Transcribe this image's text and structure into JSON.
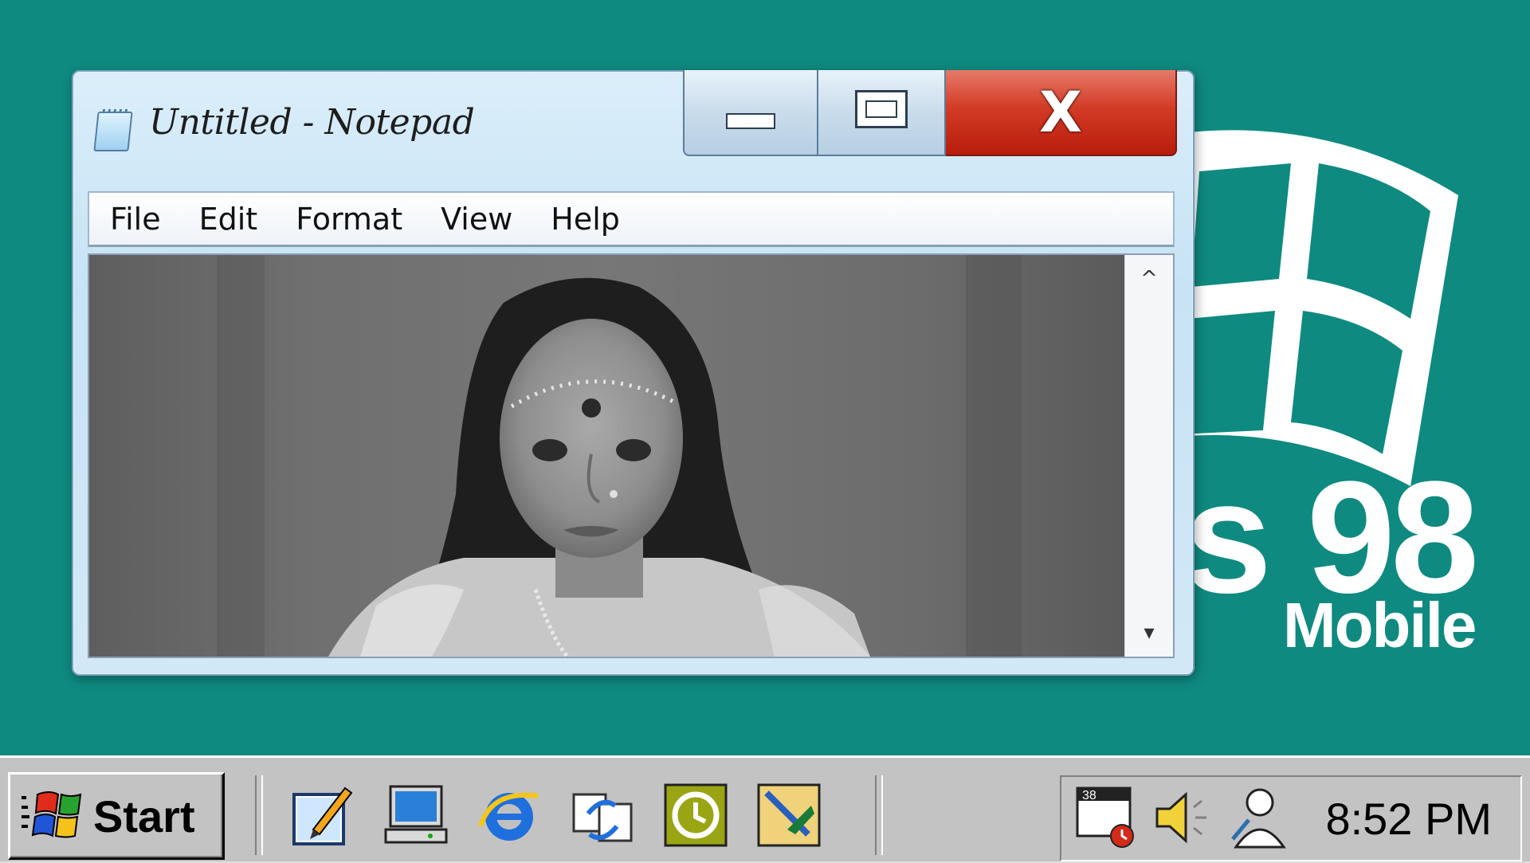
{
  "desktop": {
    "logo_os_text": "s 98",
    "logo_edition": "Mobile",
    "background_color": "#0f8a80"
  },
  "window": {
    "title": "Untitled - Notepad",
    "icon": "notepad-icon",
    "controls": {
      "minimize": "minimize-icon",
      "maximize": "maximize-icon",
      "close": "close-icon",
      "close_label": "X"
    },
    "menu": [
      "File",
      "Edit",
      "Format",
      "View",
      "Help"
    ],
    "content": {
      "type": "photo",
      "description_icon": "grayscale-portrait-image"
    },
    "scrollbar": {
      "up": "^",
      "down": "▾"
    }
  },
  "taskbar": {
    "start_label": "Start",
    "quick_launch": [
      "notepad-edit-icon",
      "my-computer-icon",
      "internet-explorer-icon",
      "sync-icon",
      "clock-app-icon",
      "paint-icon"
    ],
    "tray_icons": [
      "scheduler-icon",
      "volume-icon",
      "user-network-icon"
    ],
    "clock": "8:52 PM"
  }
}
